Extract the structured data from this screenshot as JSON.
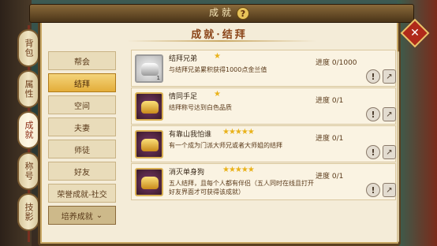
{
  "window": {
    "title": "成就",
    "subtitle": "成就·结拜"
  },
  "side_tabs": [
    {
      "label": "背包",
      "active": false
    },
    {
      "label": "属性",
      "active": false
    },
    {
      "label": "成就",
      "active": true
    },
    {
      "label": "称号",
      "active": false
    },
    {
      "label": "技影",
      "active": false
    }
  ],
  "categories": [
    {
      "label": "帮会",
      "active": false
    },
    {
      "label": "结拜",
      "active": true
    },
    {
      "label": "空间",
      "active": false
    },
    {
      "label": "夫妻",
      "active": false
    },
    {
      "label": "师徒",
      "active": false
    },
    {
      "label": "好友",
      "active": false
    },
    {
      "label": "荣誉成就-社交",
      "active": false
    }
  ],
  "dropdown": {
    "label": "培养成就",
    "arrow": "⌄"
  },
  "achievements": [
    {
      "name": "结拜兄弟",
      "stars": "★",
      "desc": "与结拜兄弟累积获得1000点金兰值",
      "progress": "进度 0/1000",
      "icon": "silver-ingot-icon",
      "qty": "1"
    },
    {
      "name": "情同手足",
      "stars": "★",
      "desc": "结拜称号达到白色品质",
      "progress": "进度 0/1",
      "icon": "gold-ingot-icon",
      "qty": ""
    },
    {
      "name": "有靠山我怕谁",
      "stars": "★★★★★",
      "desc": "有一个成为门派大师兄或者大师姐的结拜",
      "progress": "进度 0/1",
      "icon": "gold-ingot-icon",
      "qty": ""
    },
    {
      "name": "消灭单身狗",
      "stars": "★★★★★",
      "desc": "五人结拜，且每个人都有伴侣（五人同时在线且打开好友界面才可获得该成就）",
      "progress": "进度 0/1",
      "icon": "gold-ingot-icon",
      "qty": ""
    }
  ],
  "icons": {
    "help": "?",
    "close": "✕",
    "info": "!",
    "share": "↗"
  }
}
